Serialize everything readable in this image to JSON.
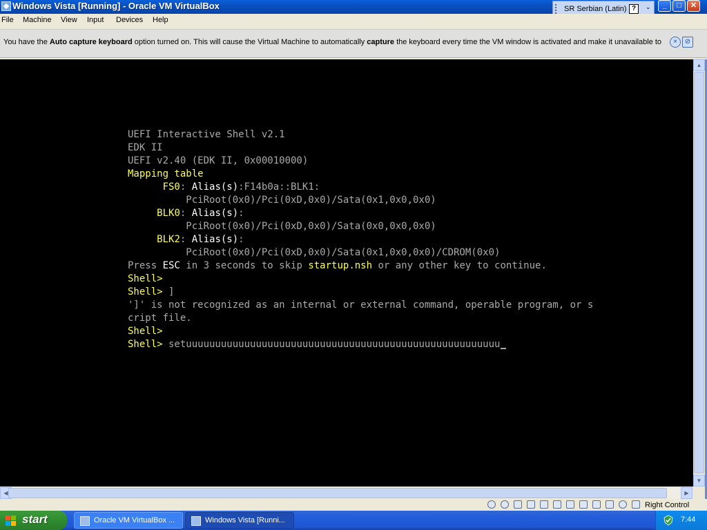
{
  "window": {
    "title": "Windows Vista [Running] - Oracle VM VirtualBox",
    "controls": [
      "minimize",
      "maximize",
      "close"
    ]
  },
  "langbar": {
    "language": "SR Serbian (Latin)",
    "help": "?"
  },
  "menu": [
    "File",
    "Machine",
    "View",
    "Input",
    "Devices",
    "Help"
  ],
  "notification": {
    "pre": "You have the ",
    "bold1": "Auto capture keyboard",
    "mid": " option turned on. This will cause the Virtual Machine to automatically ",
    "bold2": "capture",
    "post": " the keyboard every time the VM window is activated and make it unavailable to"
  },
  "console": {
    "lines": [
      [
        {
          "t": "UEFI Interactive Shell v2.1",
          "c": "n"
        }
      ],
      [
        {
          "t": "EDK II",
          "c": "n"
        }
      ],
      [
        {
          "t": "UEFI v2.40 (EDK II, 0x00010000)",
          "c": "n"
        }
      ],
      [
        {
          "t": "Mapping table",
          "c": "y"
        }
      ],
      [
        {
          "t": "      ",
          "c": "n"
        },
        {
          "t": "FS0",
          "c": "y"
        },
        {
          "t": ": ",
          "c": "n"
        },
        {
          "t": "Alias(s)",
          "c": "w"
        },
        {
          "t": ":F14b0a::BLK1:",
          "c": "n"
        }
      ],
      [
        {
          "t": "          PciRoot(0x0)/Pci(0xD,0x0)/Sata(0x1,0x0,0x0)",
          "c": "n"
        }
      ],
      [
        {
          "t": "     ",
          "c": "n"
        },
        {
          "t": "BLK0",
          "c": "y"
        },
        {
          "t": ": ",
          "c": "n"
        },
        {
          "t": "Alias(s)",
          "c": "w"
        },
        {
          "t": ":",
          "c": "n"
        }
      ],
      [
        {
          "t": "          PciRoot(0x0)/Pci(0xD,0x0)/Sata(0x0,0x0,0x0)",
          "c": "n"
        }
      ],
      [
        {
          "t": "     ",
          "c": "n"
        },
        {
          "t": "BLK2",
          "c": "y"
        },
        {
          "t": ": ",
          "c": "n"
        },
        {
          "t": "Alias(s)",
          "c": "w"
        },
        {
          "t": ":",
          "c": "n"
        }
      ],
      [
        {
          "t": "          PciRoot(0x0)/Pci(0xD,0x0)/Sata(0x1,0x0,0x0)/CDROM(0x0)",
          "c": "n"
        }
      ],
      [
        {
          "t": "Press ",
          "c": "n"
        },
        {
          "t": "ESC",
          "c": "w"
        },
        {
          "t": " in 3 seconds to skip ",
          "c": "n"
        },
        {
          "t": "startup.nsh",
          "c": "y"
        },
        {
          "t": " or any other key to continue.",
          "c": "n"
        }
      ],
      [
        {
          "t": "Shell>",
          "c": "y"
        }
      ],
      [
        {
          "t": "Shell>",
          "c": "y"
        },
        {
          "t": " ]",
          "c": "n"
        }
      ],
      [
        {
          "t": "']' is not recognized as an internal or external command, operable program, or s",
          "c": "n"
        }
      ],
      [
        {
          "t": "cript file.",
          "c": "n"
        }
      ],
      [
        {
          "t": "Shell>",
          "c": "y"
        }
      ],
      [
        {
          "t": "Shell>",
          "c": "y"
        },
        {
          "t": " setuuuuuuuuuuuuuuuuuuuuuuuuuuuuuuuuuuuuuuuuuuuuuuuuuuuuuu",
          "c": "n"
        }
      ]
    ]
  },
  "statusbar": {
    "host_key": "Right Control"
  },
  "taskbar": {
    "start": "start",
    "tasks": [
      "Oracle VM VirtualBox ...",
      "Windows Vista [Runni..."
    ],
    "clock": "7:44"
  }
}
